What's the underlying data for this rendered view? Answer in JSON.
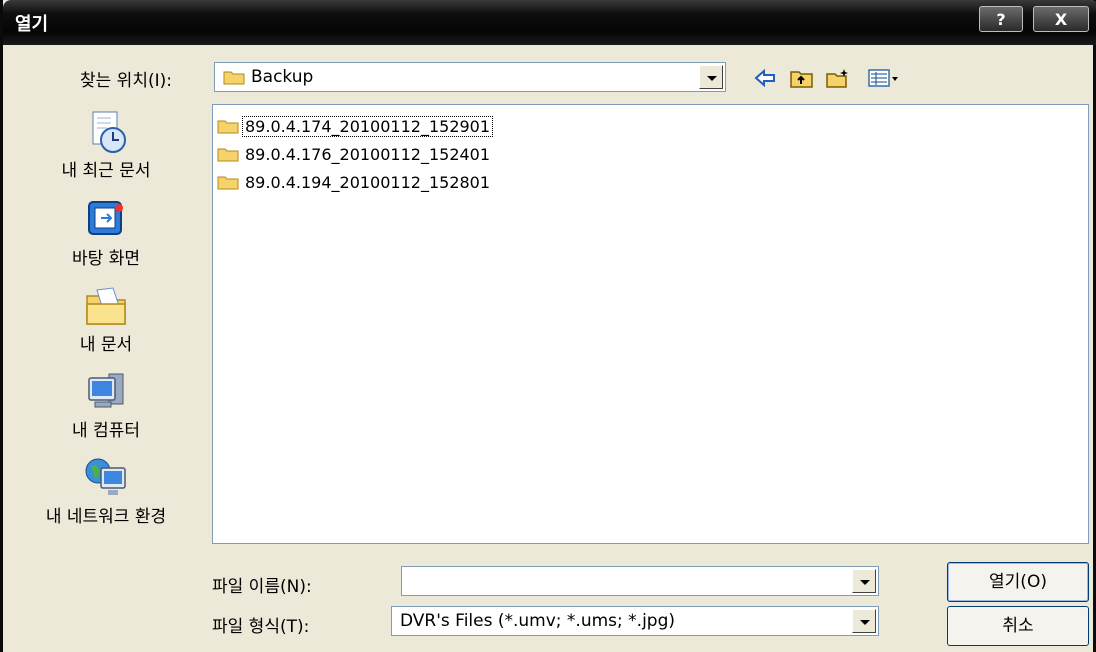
{
  "window": {
    "title": "열기",
    "help_label": "?",
    "close_label": "X"
  },
  "toolbar": {
    "lookin_label": "찾는 위치(I):",
    "lookin_value": "Backup",
    "icons": [
      "back-icon",
      "up-folder-icon",
      "new-folder-icon",
      "view-menu-icon"
    ]
  },
  "places": [
    {
      "label": "내 최근 문서",
      "icon": "recent-documents-icon"
    },
    {
      "label": "바탕 화면",
      "icon": "desktop-icon"
    },
    {
      "label": "내 문서",
      "icon": "my-documents-icon"
    },
    {
      "label": "내 컴퓨터",
      "icon": "my-computer-icon"
    },
    {
      "label": "내 네트워크 환경",
      "icon": "network-places-icon"
    }
  ],
  "files": [
    {
      "name": "89.0.4.174_20100112_152901",
      "selected": true
    },
    {
      "name": "89.0.4.176_20100112_152401",
      "selected": false
    },
    {
      "name": "89.0.4.194_20100112_152801",
      "selected": false
    }
  ],
  "filename": {
    "label": "파일 이름(N):",
    "value": ""
  },
  "filetype": {
    "label": "파일 형식(T):",
    "value": "DVR's Files (*.umv; *.ums; *.jpg)"
  },
  "buttons": {
    "open": "열기(O)",
    "cancel": "취소"
  }
}
